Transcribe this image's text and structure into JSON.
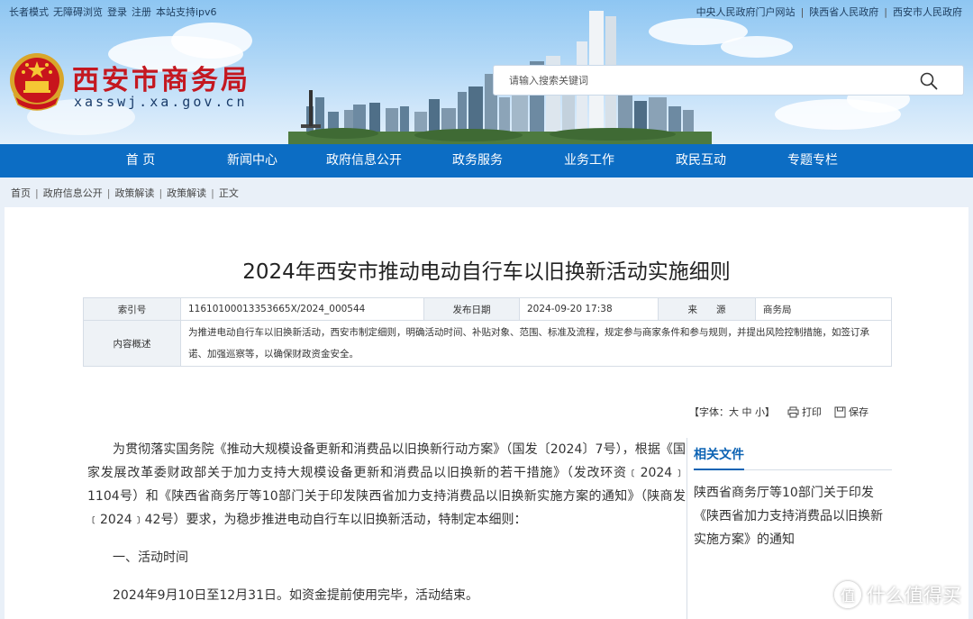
{
  "top_links_left": [
    "长者模式",
    "无障碍浏览",
    "登录",
    "注册",
    "本站支持ipv6"
  ],
  "top_links_right": [
    "中央人民政府门户网站",
    "陕西省人民政府",
    "西安市人民政府"
  ],
  "site": {
    "title": "西安市商务局",
    "domain": "xasswj.xa.gov.cn"
  },
  "search": {
    "placeholder": "请输入搜索关键词",
    "icon": "search-icon"
  },
  "nav": [
    "首 页",
    "新闻中心",
    "政府信息公开",
    "政务服务",
    "业务工作",
    "政民互动",
    "专题专栏"
  ],
  "breadcrumb": [
    "首页",
    "政府信息公开",
    "政策解读",
    "政策解读",
    "正文"
  ],
  "article": {
    "title": "2024年西安市推动电动自行车以旧换新活动实施细则",
    "info": {
      "index_label": "索引号",
      "index_value": "11610100013353665X/2024_000544",
      "date_label": "发布日期",
      "date_value": "2024-09-20 17:38",
      "source_label": "来　　源",
      "source_value": "商务局",
      "summary_label": "内容概述",
      "summary_value": "为推进电动自行车以旧换新活动，西安市制定细则，明确活动时间、补贴对象、范围、标准及流程，规定参与商家条件和参与规则，并提出风险控制措施，如签订承诺、加强巡察等，以确保财政资金安全。"
    },
    "tools": {
      "font_prefix": "【字体：",
      "font_large": "大",
      "font_medium": "中",
      "font_small": "小",
      "font_suffix": "】",
      "print": "打印",
      "save": "保存"
    },
    "paragraphs": [
      "为贯彻落实国务院《推动大规模设备更新和消费品以旧换新行动方案》（国发〔2024〕7号），根据《国家发展改革委财政部关于加力支持大规模设备更新和消费品以旧换新的若干措施》（发改环资﹝2024﹞1104号）和《陕西省商务厅等10部门关于印发陕西省加力支持消费品以旧换新实施方案的通知》（陕商发﹝2024﹞42号）要求，为稳步推进电动自行车以旧换新活动，特制定本细则：",
      "一、活动时间",
      "2024年9月10日至12月31日。如资金提前使用完毕，活动结束。"
    ]
  },
  "related": {
    "title": "相关文件",
    "items": [
      "陕西省商务厅等10部门关于印发《陕西省加力支持消费品以旧换新实施方案》的通知"
    ]
  },
  "watermark": {
    "symbol": "值",
    "text": "什么值得买"
  },
  "colors": {
    "nav_bg": "#0c6dc4",
    "title_red": "#c41820",
    "link_blue": "#0c63b4"
  }
}
